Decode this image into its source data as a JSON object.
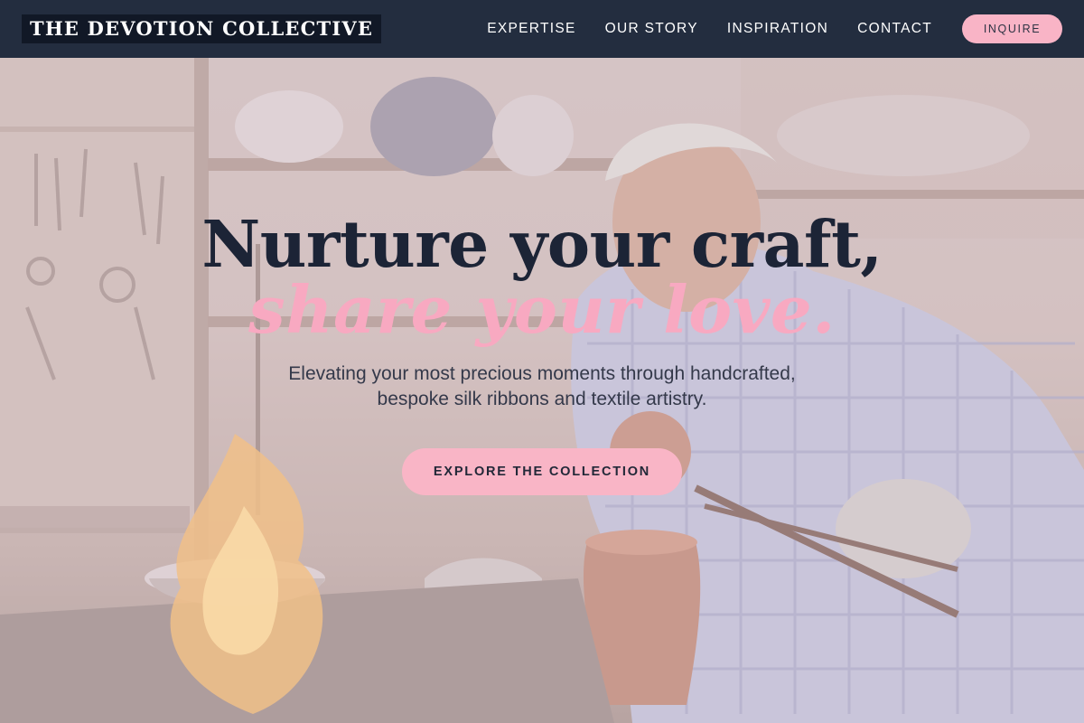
{
  "brand": {
    "name": "THE DEVOTION COLLECTIVE"
  },
  "nav": {
    "links": [
      {
        "label": "EXPERTISE"
      },
      {
        "label": "OUR STORY"
      },
      {
        "label": "INSPIRATION"
      },
      {
        "label": "CONTACT"
      }
    ],
    "inquire_label": "INQUIRE"
  },
  "hero": {
    "headline_line1": "Nurture your craft,",
    "headline_line2": "share your love.",
    "subhead_line1": "Elevating your most precious moments through handcrafted,",
    "subhead_line2": "bespoke silk ribbons and textile artistry.",
    "cta_label": "EXPLORE THE COLLECTION",
    "background_image": "artisan-workshop-photo"
  },
  "colors": {
    "nav_bg": "#232d3f",
    "brand_bg": "#111826",
    "accent_pink": "#f9b4c6",
    "headline_navy": "#1c2436",
    "headline_pink": "#f8a9c1"
  }
}
